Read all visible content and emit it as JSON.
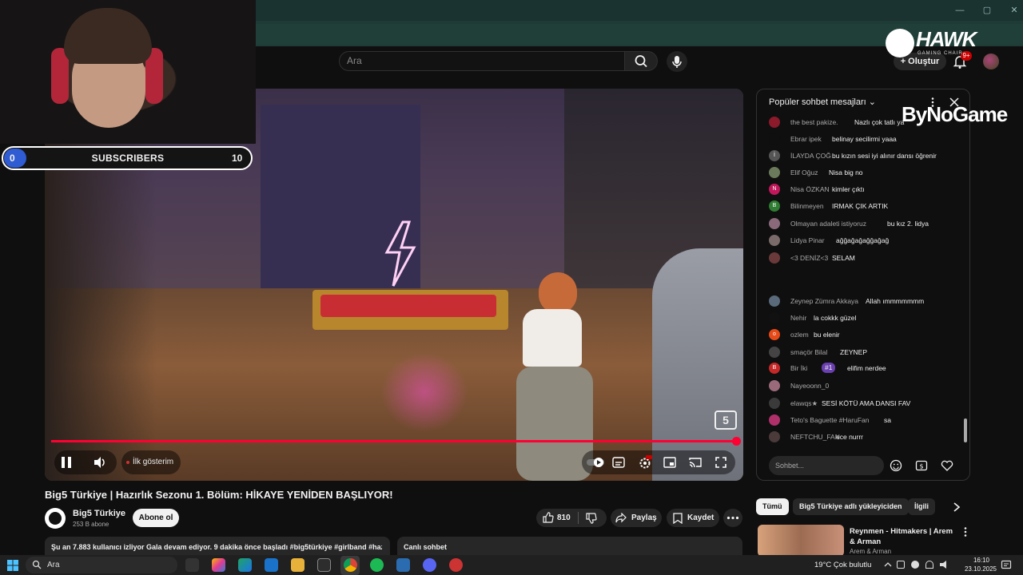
{
  "browser": {
    "window_controls": [
      "—",
      "▢",
      "✕"
    ]
  },
  "youtube_header": {
    "search_placeholder": "Ara",
    "create_label": "Oluştur",
    "notification_count": "9+"
  },
  "stream_overlay": {
    "subscriber_bar": {
      "start": "0",
      "label": "SUBSCRIBERS",
      "goal": "10",
      "progress_fraction": 0
    },
    "hawk_brand": "HAWK",
    "hawk_sub": "GAMING CHAIR",
    "sponsor": "ByNoGame"
  },
  "player": {
    "preview_label": "İlk gösterim",
    "watermark": "5",
    "progress_fraction": 1.0
  },
  "video": {
    "title": "Big5 Türkiye | Hazırlık Sezonu 1. Bölüm: HİKAYE YENİDEN BAŞLIYOR!",
    "channel_name": "Big5 Türkiye",
    "channel_subs": "253 B abone",
    "subscribe_label": "Abone ol",
    "likes": "810",
    "share_label": "Paylaş",
    "save_label": "Kaydet",
    "description": "Şu an 7.883 kullanıcı izliyor  Gala devam ediyor. 9 dakika önce başladı  #big5türkiye #girlband #haz",
    "live_chat_label": "Canlı sohbet"
  },
  "chat": {
    "header": "Popüler sohbet mesajları",
    "input_placeholder": "Sohbet...",
    "messages": [
      {
        "author": "the best pakize.",
        "text": "Nazlı çok tatlı ya",
        "avatar": "",
        "color": "#8b1a2a"
      },
      {
        "author": "Ebrar ipek",
        "text": "belinay secilirmi yaaa",
        "avatar": "",
        "color": "#0f0f0f"
      },
      {
        "author": "İLAYDA ÇOĞ",
        "text": "bu kızın sesi iyi alınır dansı öğrenir",
        "avatar": "İ",
        "color": "#555"
      },
      {
        "author": "Elif Oğuz",
        "text": "Nisa big no",
        "avatar": "",
        "color": "#6a7a5a"
      },
      {
        "author": "Nisa ÖZKAN",
        "text": "kimler çıktı",
        "avatar": "N",
        "color": "#c2185b"
      },
      {
        "author": "Bilinmeyen",
        "text": "IRMAK ÇIK ARTIK",
        "avatar": "B",
        "color": "#2e7d32"
      },
      {
        "author": "Olmayan adaleti istiyoruz",
        "text": "bu kız 2. lidya",
        "avatar": "",
        "color": "#8a6a7a"
      },
      {
        "author": "Lidya Pinar",
        "text": "ağğağağağğağağ",
        "avatar": "",
        "color": "#7a6a6a"
      },
      {
        "author": "<3 DENİZ<3",
        "text": "SELAM",
        "avatar": "",
        "color": "#6a3a3a"
      },
      {
        "author": "Zeynep Zümra Akkaya",
        "text": "Allah ımmmmmmm",
        "avatar": "",
        "color": "#5a6a7a"
      },
      {
        "author": "Nehir",
        "text": "la cokkk güzel",
        "avatar": "",
        "color": "#111"
      },
      {
        "author": "ozlem",
        "text": "bu elenir",
        "avatar": "o",
        "color": "#e64a19"
      },
      {
        "author": "smaçör Bilal",
        "text": "ZEYNEP",
        "avatar": "",
        "color": "#444"
      },
      {
        "author": "Bir İki",
        "text": "elifim nerdee",
        "badge": "#1",
        "avatar": "B",
        "color": "#c62828"
      },
      {
        "author": "Nayeoonn_0",
        "text": "",
        "avatar": "",
        "color": "#9a6a7a"
      },
      {
        "author": "elawqs★",
        "text": "SESİ KÖTÜ AMA DANSI FAV",
        "avatar": "",
        "color": "#3a3a3a"
      },
      {
        "author": "Teto's Baguette #HaruFan",
        "text": "sa",
        "avatar": "",
        "color": "#b0306a"
      },
      {
        "author": "NEFTCHU_FAN",
        "text": "ece nurrr",
        "avatar": "",
        "color": "#4a3a3a"
      }
    ]
  },
  "related": {
    "chips": [
      "Tümü",
      "Big5 Türkiye adlı yükleyiciden",
      "İlgili"
    ],
    "first_video_title": "Reynmen - Hitmakers | Arem & Arman",
    "first_video_channel": "Arem & Arman"
  },
  "taskbar": {
    "search_text": "Ara",
    "weather": "19°C  Çok bulutlu",
    "time": "16:10",
    "date": "23.10.2025"
  },
  "colors": {
    "accent": "#ff0033",
    "subscriber_fill": "#2f5bd3"
  }
}
